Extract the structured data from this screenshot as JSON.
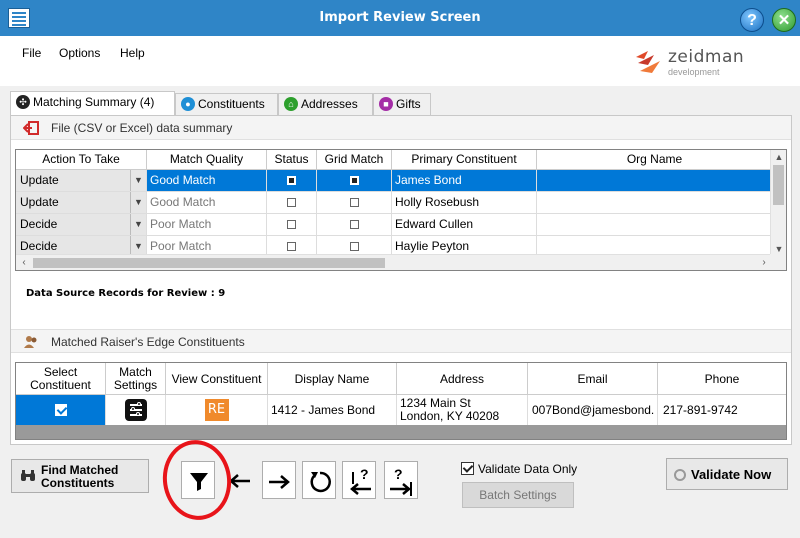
{
  "window": {
    "title": "Import Review Screen",
    "help_label": "?",
    "close_label": "✕"
  },
  "menu": [
    "File",
    "Options",
    "Help"
  ],
  "logo": {
    "name": "zeidman",
    "tagline": "development"
  },
  "tabs": [
    {
      "label": "Matching Summary (4)",
      "icon": "matching-summary-icon",
      "color": "#222222",
      "active": true
    },
    {
      "label": "Constituents",
      "icon": "constituents-icon",
      "color": "#1e8fd6",
      "active": false
    },
    {
      "label": "Addresses",
      "icon": "home-icon",
      "color": "#2c9f2c",
      "active": false
    },
    {
      "label": "Gifts",
      "icon": "gift-icon",
      "color": "#a42da6",
      "active": false
    }
  ],
  "file_section": {
    "title": "File (CSV or Excel) data summary"
  },
  "grid1": {
    "columns": [
      "Action To Take",
      "Match Quality",
      "Status",
      "Grid Match",
      "Primary Constituent",
      "Org Name"
    ],
    "rows": [
      {
        "action": "Update",
        "quality": "Good Match",
        "status_checked": true,
        "grid_checked": true,
        "constituent": "James Bond",
        "org": "",
        "selected": true
      },
      {
        "action": "Update",
        "quality": "Good Match",
        "status_checked": false,
        "grid_checked": false,
        "constituent": "Holly Rosebush",
        "org": "",
        "selected": false
      },
      {
        "action": "Decide",
        "quality": "Poor Match",
        "status_checked": false,
        "grid_checked": false,
        "constituent": "Edward Cullen",
        "org": "",
        "selected": false
      },
      {
        "action": "Decide",
        "quality": "Poor Match",
        "status_checked": false,
        "grid_checked": false,
        "constituent": "Haylie Peyton",
        "org": "",
        "selected": false
      }
    ]
  },
  "records_summary": "Data Source Records for Review : 9",
  "matched_section": {
    "title": "Matched Raiser's Edge Constituents"
  },
  "grid2": {
    "columns": [
      "Select Constituent",
      "Match Settings",
      "View Constituent",
      "Display Name",
      "Address",
      "Email",
      "Phone"
    ],
    "row": {
      "selected": true,
      "view_label": "RE",
      "display_name": "1412 - James Bond",
      "address_line1": "1234 Main St",
      "address_line2": "London, KY  40208",
      "email": "007Bond@jamesbond.",
      "phone": "217-891-9742"
    }
  },
  "toolbar": {
    "find_label_1": "Find Matched",
    "find_label_2": "Constituents",
    "validate_only_label": "Validate Data Only",
    "validate_only_checked": true,
    "batch_settings_label": "Batch Settings",
    "validate_now_label": "Validate Now",
    "tool_icons": [
      "filter-icon",
      "arrow-left-icon",
      "arrow-right-icon",
      "refresh-icon",
      "prev-question-icon",
      "next-question-icon"
    ]
  },
  "colors": {
    "titlebar": "#2f85c7",
    "selection": "#0078d7",
    "annotation": "#e8141a",
    "re_orange": "#f08a2c"
  }
}
